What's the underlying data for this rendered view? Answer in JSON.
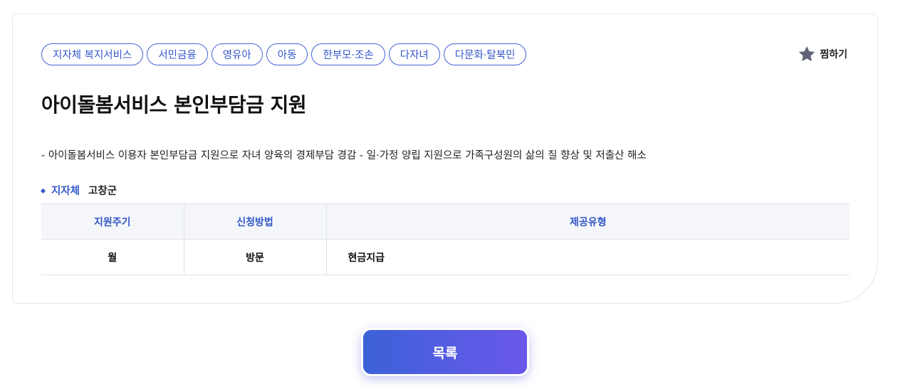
{
  "tags": [
    "지자체 복지서비스",
    "서민금융",
    "영유아",
    "아동",
    "한부모·조손",
    "다자녀",
    "다문화·탈북민"
  ],
  "favorite": {
    "label": "찜하기",
    "icon": "star-icon"
  },
  "title": "아이돌봄서비스 본인부담금 지원",
  "description": "- 아이돌봄서비스 이용자 본인부담금 지원으로 자녀 양육의 경제부담 경감 - 일·가정 양립 지원으로 가족구성원의 삶의 질 향상 및 저출산 해소",
  "region": {
    "label": "지자체",
    "value": "고창군"
  },
  "table": {
    "headers": [
      "지원주기",
      "신청방법",
      "제공유형"
    ],
    "row": [
      "월",
      "방문",
      "현금지급"
    ]
  },
  "list_button": "목록",
  "colors": {
    "accent": "#3457c9",
    "button_start": "#3c62d8",
    "button_end": "#6a57ea"
  }
}
